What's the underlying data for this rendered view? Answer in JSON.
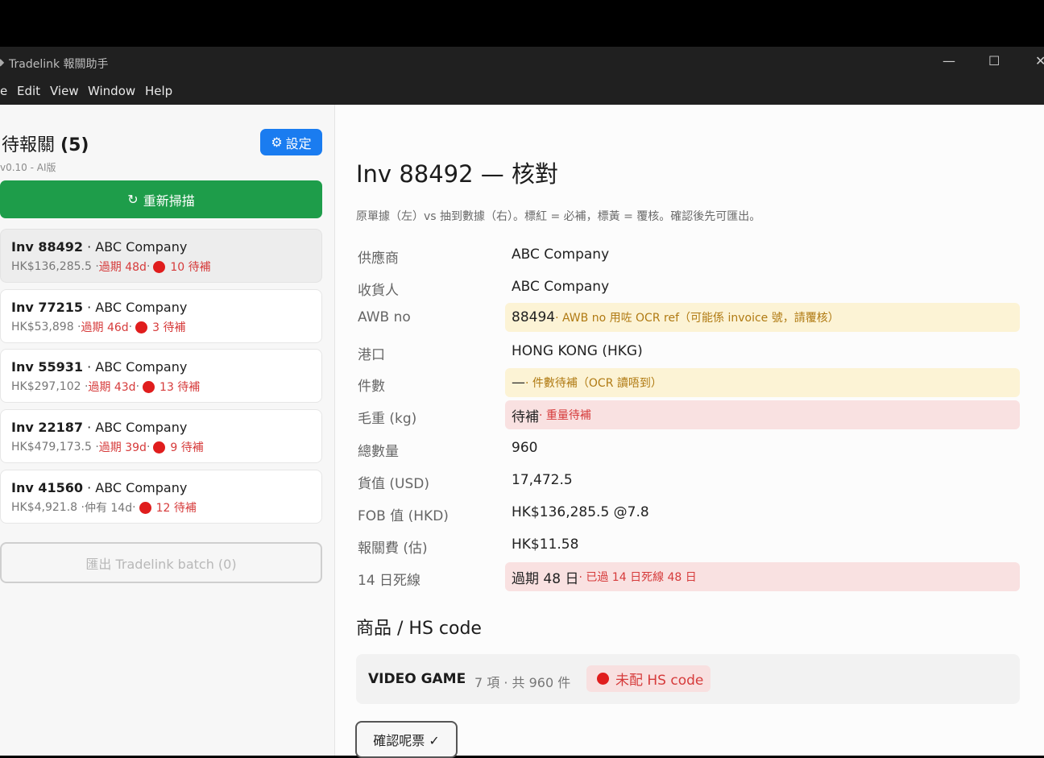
{
  "window": {
    "title": "Tradelink 報關助手",
    "minimize": "—",
    "maximize": "☐",
    "close": "✕"
  },
  "menu": [
    "e",
    "Edit",
    "View",
    "Window",
    "Help"
  ],
  "sidebar": {
    "title": "待報關",
    "count": "(5)",
    "version": "v0.10 - AI版",
    "settings_label": "設定",
    "rescan_label": "重新掃描",
    "export_label": "匯出 Tradelink batch (0)",
    "invoices": [
      {
        "inv": "Inv 88492",
        "company": "· ABC Company",
        "amount": "HK$136,285.5 · ",
        "status": "過期 48d",
        "status_kind": "red",
        "sep": " · ",
        "pending": "10 待補"
      },
      {
        "inv": "Inv 77215",
        "company": "· ABC Company",
        "amount": "HK$53,898 · ",
        "status": "過期 46d",
        "status_kind": "red",
        "sep": " · ",
        "pending": "3 待補"
      },
      {
        "inv": "Inv 55931",
        "company": "· ABC Company",
        "amount": "HK$297,102 · ",
        "status": "過期 43d",
        "status_kind": "red",
        "sep": " · ",
        "pending": "13 待補"
      },
      {
        "inv": "Inv 22187",
        "company": "· ABC Company",
        "amount": "HK$479,173.5 · ",
        "status": "過期 39d",
        "status_kind": "red",
        "sep": " · ",
        "pending": "9 待補"
      },
      {
        "inv": "Inv 41560",
        "company": "· ABC Company",
        "amount": "HK$4,921.8 · ",
        "status": "仲有 14d",
        "status_kind": "gray",
        "sep": " · ",
        "pending": "12 待補"
      }
    ]
  },
  "main": {
    "title": "Inv 88492 — 核對",
    "subtitle": "原單據（左）vs 抽到數據（右）。標紅 = 必補，標黃 = 覆核。確認後先可匯出。",
    "fields": [
      {
        "label": "供應商",
        "value": "ABC Company",
        "note": "",
        "state": "ok"
      },
      {
        "label": "收貨人",
        "value": "ABC Company",
        "note": "",
        "state": "ok"
      },
      {
        "label": "AWB no",
        "value": "88494",
        "note": " · AWB no 用咗 OCR ref（可能係 invoice 號，請覆核）",
        "state": "warn"
      },
      {
        "label": "港口",
        "value": "HONG KONG (HKG)",
        "note": "",
        "state": "ok"
      },
      {
        "label": "件數",
        "value": "—",
        "note": " · 件數待補（OCR 讀唔到）",
        "state": "warn"
      },
      {
        "label": "毛重 (kg)",
        "value": "待補",
        "note": " · 重量待補",
        "state": "err"
      },
      {
        "label": "總數量",
        "value": "960",
        "note": "",
        "state": "ok"
      },
      {
        "label": "貨值 (USD)",
        "value": "17,472.5",
        "note": "",
        "state": "ok"
      },
      {
        "label": "FOB 值 (HKD)",
        "value": "HK$136,285.5 @7.8",
        "note": "",
        "state": "ok"
      },
      {
        "label": "報關費 (估)",
        "value": "HK$11.58",
        "note": "",
        "state": "ok"
      },
      {
        "label": "14 日死線",
        "value": "過期 48 日",
        "note": " · 已過 14 日死線 48 日",
        "state": "err"
      }
    ],
    "goods_section_title": "商品 / HS code",
    "goods": {
      "name": "VIDEO GAME",
      "meta": "7 項 · 共 960 件",
      "hs_status": "未配 HS code"
    },
    "confirm_label": "確認呢票 ✓"
  }
}
